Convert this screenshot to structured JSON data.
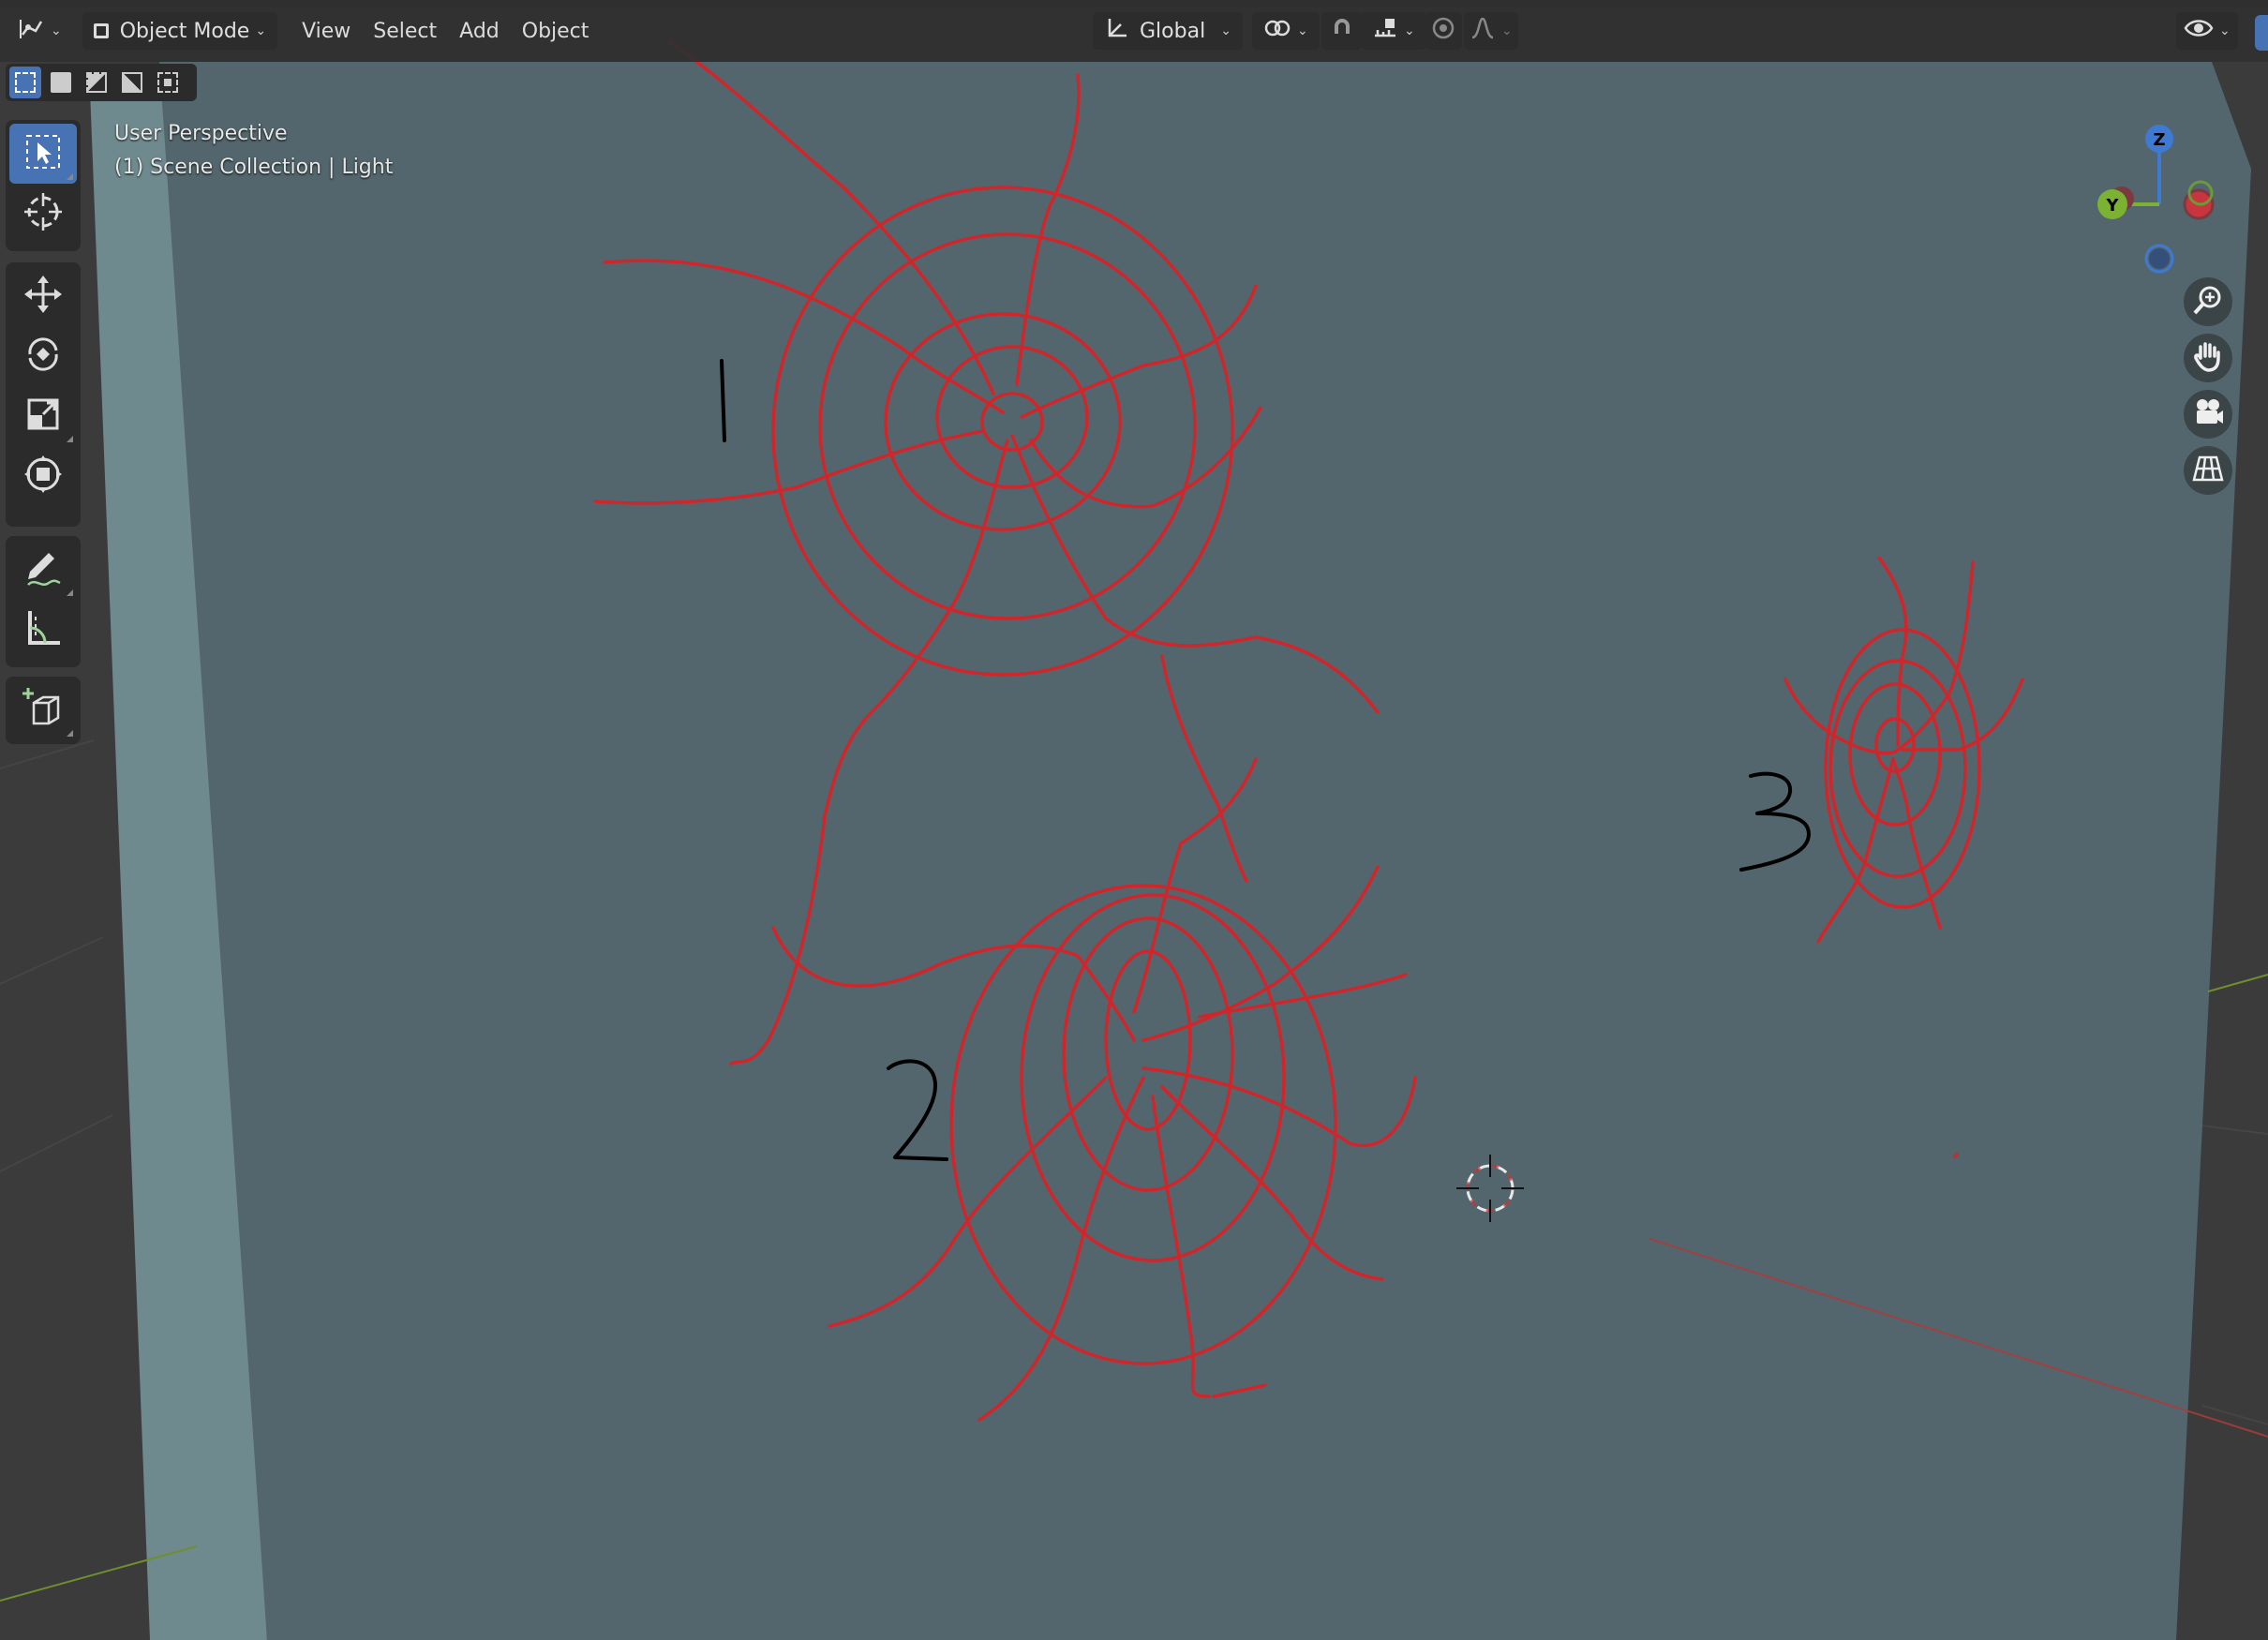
{
  "header": {
    "editor_type_icon": "3d-viewport-icon",
    "mode": "Object Mode",
    "menus": [
      "View",
      "Select",
      "Add",
      "Object"
    ],
    "transform_orientation": "Global",
    "pivot_icon": "pivot-point-icon",
    "snap_icon": "magnet-icon",
    "snap_target_icon": "snap-increment-icon",
    "proportional_icon": "proportional-edit-icon",
    "falloff_icon": "falloff-curve-icon",
    "visibility_icon": "eye-visibility-icon"
  },
  "select_modes": [
    "set",
    "extend",
    "subtract",
    "invert",
    "intersect"
  ],
  "toolbar": {
    "group1": [
      {
        "name": "select-box",
        "icon": "cursor-select-icon",
        "active": true
      },
      {
        "name": "cursor",
        "icon": "3d-cursor-icon",
        "active": false
      }
    ],
    "group2": [
      {
        "name": "move",
        "icon": "move-icon"
      },
      {
        "name": "rotate",
        "icon": "rotate-icon"
      },
      {
        "name": "scale",
        "icon": "scale-icon"
      },
      {
        "name": "transform",
        "icon": "transform-icon"
      }
    ],
    "group3": [
      {
        "name": "annotate",
        "icon": "annotate-pencil-icon"
      },
      {
        "name": "measure",
        "icon": "measure-ruler-icon"
      }
    ],
    "group4": [
      {
        "name": "add-cube",
        "icon": "add-cube-icon"
      }
    ]
  },
  "viewport": {
    "view_name": "User Perspective",
    "collection_info": "(1) Scene Collection | Light",
    "annotations": [
      "1",
      "2",
      "3"
    ],
    "plane_color": "#53666d",
    "stroke_color": "#d0262b"
  },
  "gizmo": {
    "z_label": "Z",
    "y_label": "Y",
    "x_color": "#c9353f",
    "y_color": "#7bb232",
    "z_color": "#3e7ad1"
  },
  "nav_buttons": [
    {
      "name": "zoom",
      "icon": "zoom-icon"
    },
    {
      "name": "pan",
      "icon": "hand-icon"
    },
    {
      "name": "camera",
      "icon": "camera-icon"
    },
    {
      "name": "ortho",
      "icon": "grid-perspective-icon"
    }
  ]
}
